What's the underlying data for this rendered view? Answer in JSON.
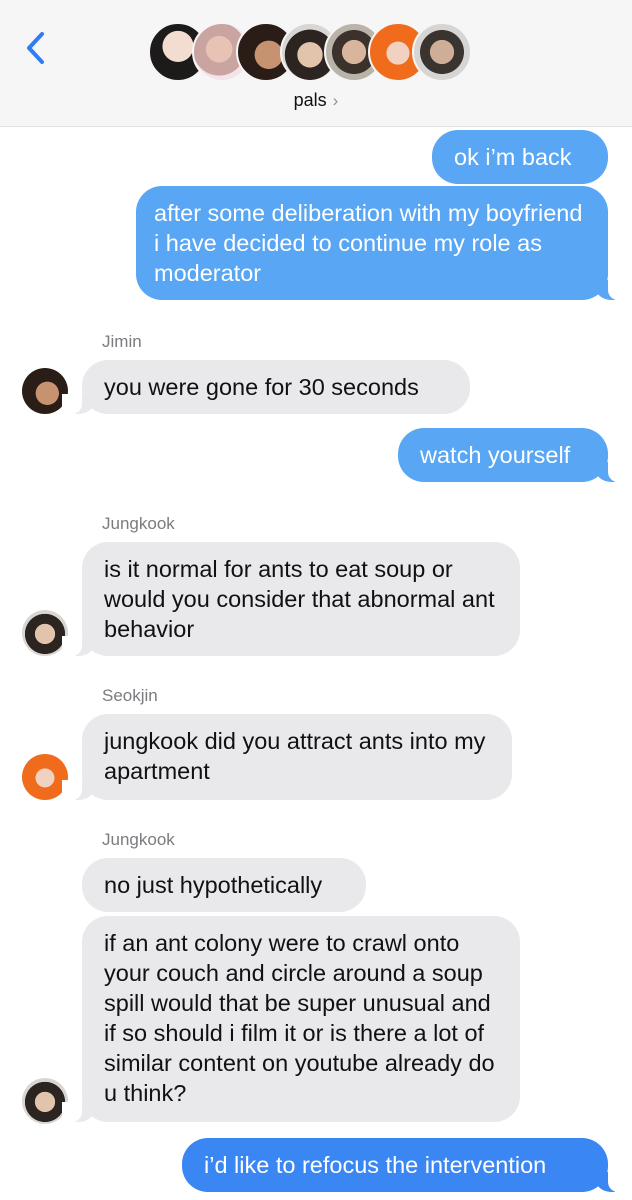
{
  "header": {
    "group_name": "pals",
    "chevron": "›",
    "back_icon": "chevron-left-icon",
    "member_avatars": [
      "avatar-1",
      "avatar-2",
      "avatar-3",
      "avatar-4",
      "avatar-5",
      "avatar-6",
      "avatar-7"
    ]
  },
  "colors": {
    "outgoing": "#58a6f4",
    "outgoing_latest": "#3a86f3",
    "incoming": "#e9e9ec",
    "accent": "#2f7cf6"
  },
  "messages": [
    {
      "from": "me",
      "text": "ok i’m back"
    },
    {
      "from": "me",
      "text": "after some deliberation with my boyfriend i have decided to continue my role as moderator"
    },
    {
      "sender": "Jimin",
      "text": "you were gone for 30 seconds"
    },
    {
      "from": "me",
      "text": "watch yourself"
    },
    {
      "sender": "Jungkook",
      "text": "is it normal for ants to eat soup or would you consider that abnormal ant behavior"
    },
    {
      "sender": "Seokjin",
      "text": "jungkook did you attract ants into my apartment"
    },
    {
      "sender": "Jungkook",
      "text": "no just hypothetically"
    },
    {
      "sender": "Jungkook",
      "text": "if an ant colony were to crawl onto your couch and circle around a soup spill would that be super unusual and if so should i film it or is there a lot of similar content on youtube already do u think?"
    },
    {
      "from": "me",
      "text": "i’d like to refocus the intervention"
    }
  ]
}
